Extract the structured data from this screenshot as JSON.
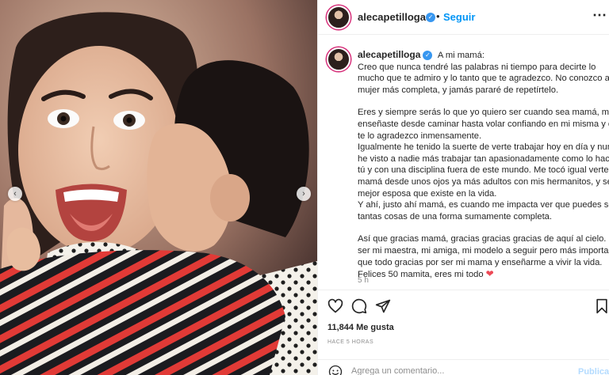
{
  "colors": {
    "accent": "#0095f6",
    "verified": "#3897f0",
    "heart": "#ed4956",
    "muted": "#8e8e8e"
  },
  "post": {
    "username": "alecapetilloga",
    "verified_icon": "verified-badge-icon",
    "separator": "•",
    "follow_label": "Seguir",
    "more_label": "•••"
  },
  "caption": {
    "username": "alecapetilloga",
    "paragraphs": [
      {
        "lines": [
          "A mi mamá:",
          "Creo que nunca tendré las palabras ni tiempo para decirte lo",
          "mucho que te admiro y lo tanto que te agradezco. No conozco a",
          "mujer más completa, y jamás pararé de repetírtelo."
        ]
      },
      {
        "lines": [
          "Eres y siempre serás lo que yo quiero ser cuando sea mamá, me",
          "enseñaste desde caminar hasta volar confiando en mi misma y eso",
          "te lo agradezco inmensamente.",
          "Igualmente he tenido la suerte de verte trabajar hoy en día y nunca",
          "he visto a nadie más trabajar tan apasionadamente como lo haces",
          "tú y con una disciplina fuera de este mundo. Me tocó igual verte ser",
          "mamá desde unos ojos ya más adultos con mis hermanitos, y ser la",
          "mejor esposa que existe en la vida.",
          "Y ahí, justo ahí mamá, es cuando me impacta ver que puedes ser",
          "tantas cosas de una forma sumamente completa."
        ]
      },
      {
        "lines": [
          "Así que gracias mamá, gracias gracias gracias de aquí al cielo. Por",
          "ser mi maestra, mi amiga, mi modelo a seguir pero más importante",
          "que todo gracias por ser mi mama y enseñarme a vivir la vida.",
          "Felices 50 mamita, eres mi todo"
        ]
      }
    ],
    "heart_emoji": "❤",
    "timestamp_short": "5 h"
  },
  "actions": {
    "like_icon": "heart-icon",
    "comment_icon": "comment-icon",
    "share_icon": "paper-plane-icon",
    "save_icon": "bookmark-icon"
  },
  "likes": "11,844 Me gusta",
  "post_date": "HACE 5 HORAS",
  "comment_box": {
    "emoji_icon": "emoji-icon",
    "placeholder": "Agrega un comentario...",
    "publish_label": "Publicar"
  },
  "photo": {
    "prev_label": "‹",
    "next_label": "›"
  }
}
